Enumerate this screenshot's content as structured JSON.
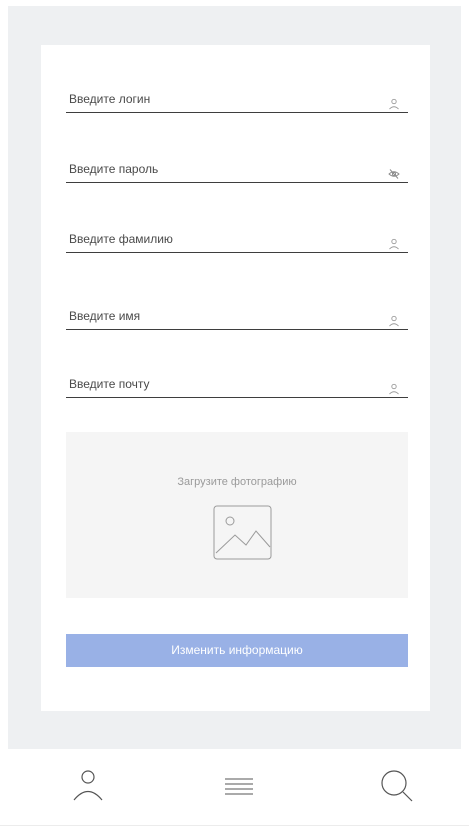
{
  "form": {
    "fields": [
      {
        "label": "Введите логин",
        "icon": "user-icon"
      },
      {
        "label": "Введите пароль",
        "icon": "eye-off-icon"
      },
      {
        "label": "Введите фамилию",
        "icon": "user-icon"
      },
      {
        "label": "Введите имя",
        "icon": "user-icon"
      },
      {
        "label": "Введите почту",
        "icon": "user-icon"
      }
    ],
    "upload": {
      "label": "Загрузите фотографию",
      "icon": "image-icon"
    },
    "submit_label": "Изменить информацию"
  },
  "bottom_nav": {
    "items": [
      {
        "icon": "profile-icon"
      },
      {
        "icon": "menu-icon"
      },
      {
        "icon": "search-icon"
      }
    ]
  },
  "colors": {
    "page_background": "#eef0f2",
    "card_background": "#ffffff",
    "button_background": "#99b1e6",
    "upload_background": "#f5f5f5",
    "field_underline": "#3e3e3e"
  }
}
